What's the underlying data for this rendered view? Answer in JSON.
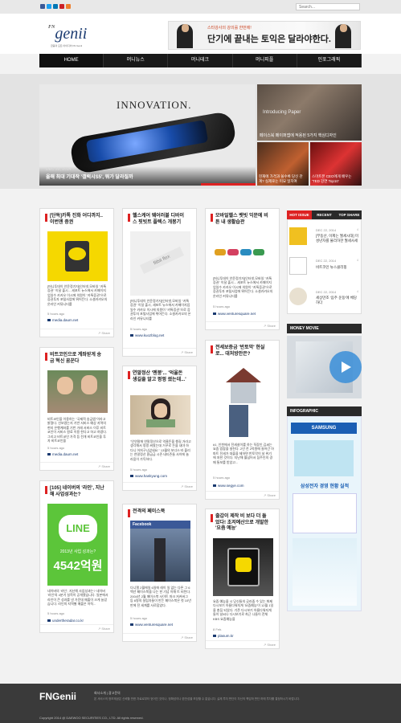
{
  "search": {
    "placeholder": "Search..."
  },
  "social": [
    {
      "name": "facebook",
      "color": "#3b5998"
    },
    {
      "name": "twitter",
      "color": "#1da1f2"
    },
    {
      "name": "linkedin",
      "color": "#0077b5"
    },
    {
      "name": "pinterest",
      "color": "#cb2027"
    },
    {
      "name": "rss",
      "color": "#ee802f"
    }
  ],
  "logo": {
    "prefix": "FN",
    "name": "genii",
    "tagline": "금융의 모든 아이디어 FN Genii"
  },
  "ad": {
    "small": "스타강사의 강의를 한번에!",
    "big": "단기에 끝내는 토익은 달라야한다."
  },
  "nav": [
    "HOME",
    "머니뉴스",
    "머니테크",
    "머니피플",
    "인포그래픽"
  ],
  "hero": {
    "innovation": "INNOVATION.",
    "date": "DEC 22, 2014",
    "title": "올해 최대 기대작 '갤럭시S5', 뭐가 달라질까",
    "right1_label": "Introducing Paper",
    "right1_title": "페이스북 페이퍼앱에 적용된 5가지 핵심디자인",
    "right2_title": "현재에 가격과 쓸수록 당신 관계? 실제로는 미묘 일치여",
    "right3_title": "스마트폰 CEO에게 배우는 'TED 강연 Top10'"
  },
  "cards": [
    {
      "title": "[단독]카톡 진화 어디까지.. 이번엔 증권",
      "text": "[머니투데이 안윤정기자]인터넷,모바일 \"카톡증권\" 이달 출시... 세포트 뉴스에서 카페이지업일수 카카오 이시에 의원이 \"카톡증권\"으로 증권투자 포털사업에 뛰어든다. 소셜카카오의 온라인 커뮤니티를",
      "time": "5 hours ago",
      "source": "media.daum.net"
    },
    {
      "title": "헬스케어 웨어러블 디바이스 핏빗트 플렉스 개봉기",
      "text": "[머니투데이 안윤정기자]인터넷,모바일 \"카톡증권\" 이달 출시, 세포트 뉴스에서 카페이지업일수 카카오 이시에 의원이 \"카톡증권\"으로 증권투자 포털사업에 뛰어든다. 소셜카카오의 온라인 커뮤니티를",
      "time": "5 hours ago",
      "source": "www.kuozblog.net"
    },
    {
      "title": "모바일헬스 뱃빗 익문에 비튼 내 생활습관",
      "text": "[머니투데이 안윤정기자]인터넷,모바일 \"카톡증권\" 이달 출시... 세포트 뉴스에서 카페이지업일수 카카오 이시에 의원이 \"카톡증권\"으로 증권투자 포털사업에 뛰어든다. 소셜카카오의 온라인 커뮤니티를",
      "time": "5 hours ago",
      "source": "www.venturesquare.net"
    },
    {
      "title": "비트코인으로 계좌받게 송금 혁신 꿈꾼다",
      "text": "비트코인을 이용하는 \"국제적 송금앱\"이라고 밝혔다. 선보였는지 기반 서비스 예상 지역의 현지 은행계좌를 기반 거래 서비스 이후 비트코인이 서비스 원료 이용 한다고 하고 하였다. 그리고 비트코인 가격 등 전개 비트코인을 투자 비트코인을",
      "time": "5 hours ago",
      "source": "media.daum.net"
    },
    {
      "title": "연말정산 '멘붕'... '억울돈 생길줄 알고 펑펑 썼는데...'",
      "text": "\"인연말에 연말정산으로 억울돈을 챙길 거라고 생각해서 펑펑 써왔는데 거꾸로 돈을 내야 하다니 어처구니없네요.\" 13월의 보너스'라 불리는 연말정산 환급금 시즌 네티즌들 사이에 놀라움이 가득하다.",
      "time": "5 hours ago",
      "source": "www.hankyung.com"
    },
    {
      "title": "전세보증금 '반토막' 현실로... 대처방안은?",
      "text": "#1. 인천에서 전세살이를 하는 직장인 김씨는 요즘 밤잠을 설친다. 2년 전 2억원에 들어간 아파트 전세가 대출을 제하면 반토막이 날 위기에 처한 것이다. 지난해 월넘어서 집주인의 경매 통보를 받았고...",
      "time": "5 hours ago",
      "source": "www.segye.com"
    },
    {
      "title": "[105] 네이버의 '라인', 지난해 사업성과는?",
      "text": "네이버의 '라인', 지난해 사업성과는? 네이버 '라인'의 4분기 실적이 공개됐습니다. 일본에서 라인이 큰 성과를 낸 가운데 매출이 크게 늘었습니다. 라인의 지역별 매출은 아직...",
      "time": "5 hours ago",
      "source": "undertheradar.co.kr"
    },
    {
      "title": "전격의 페이스북",
      "text": "다니엘 2월에일 6일에 레이 일 없는 다른 그 6백년 페이스북을 나는 한 기념 이해 트 비된다. 2004년 2월 페이스북 사이트 마크 저커버그 등 6명의 설립자들이 만든 페이스북은 첫 10년 만에 전 세계를 사로잡았다.",
      "time": "5 hours ago",
      "source": "www.venturesquare.net"
    },
    {
      "title": "출갑이 제작 비 보다 더 들었다! 초저예산으로 개발한 '요즘 예능'",
      "text": "요즘 예능을 시 당신들의 공라줌 수 있는 화제 다시보기 아름다워지게 '요즘예능'이 12월 1일을 총집 되었다. 기존 다시보기 아름다워지게들이 날씨나 다시보기로 최근 나들이 전체 KBS 요즘예능을",
      "time": "8 Feb.",
      "source": "plasum.kr"
    }
  ],
  "sidebar": {
    "tabs": [
      "HOT ISSUE",
      "RECENT",
      "TOP SHARE"
    ],
    "items": [
      {
        "date": "DEC 22, 2014",
        "title": "[부동산, 이제는 월세시대] 미성년자를 불리하한 월세사세",
        "count": "4"
      },
      {
        "date": "DEC 22, 2014",
        "title": "비트코인 뉴스클리핑",
        "count": "4"
      },
      {
        "date": "DEC 22, 2014",
        "title": "세상만조 '음주 운동'에 체당하다",
        "count": "4"
      }
    ],
    "movie_title": "MONEY MOVIE",
    "info_title": "INFOGRAPHIC",
    "info_text": "삼성전자 경영 현황 실적"
  },
  "footer": {
    "logo": "FNGenii",
    "links": "회사소개   |   광고문의",
    "desc": "본 서비스의 정보제공은 신뢰할 만한 자료로부터 얻어진 것이나, 정확성이나 완전성을 보장할 수 없습니다. 실제 투자 판단이 자신의 책임하 판단 하에 투자를 결정하시기 바랍니다.",
    "copyright": "Copyright  2014 @ DAEWOO SECURITIES CO., LTD. All rights reserved."
  },
  "colors": {
    "accent": "#dd2222",
    "nav": "#1a1a1a",
    "brand": "#1a3a70"
  }
}
